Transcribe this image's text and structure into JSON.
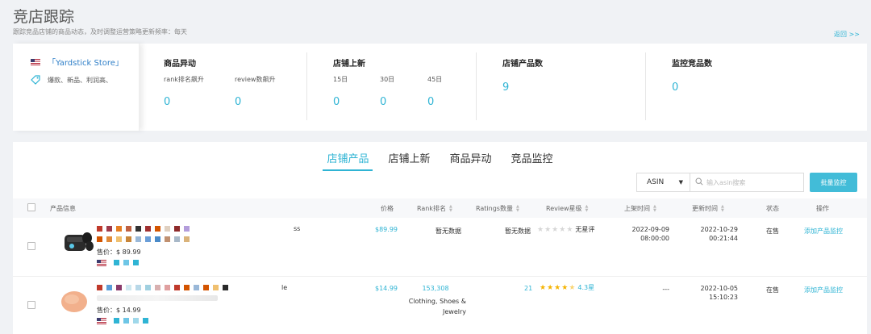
{
  "header": {
    "title": "竞店跟踪",
    "subtitle": "跟踪竞品店铺的商品动态，及时调整运营策略更新频率：每天",
    "back_label": "返回 >>"
  },
  "store": {
    "name": "「Yardstick Store」",
    "tags": "爆款、新品、利润高、"
  },
  "stats": {
    "product_change": {
      "title": "商品异动",
      "rank_label": "rank排名飙升",
      "rank_value": "0",
      "review_label": "review数飙升",
      "review_value": "0"
    },
    "new_listing": {
      "title": "店铺上新",
      "d15_label": "15日",
      "d15_value": "0",
      "d30_label": "30日",
      "d30_value": "0",
      "d45_label": "45日",
      "d45_value": "0"
    },
    "product_count": {
      "title": "店铺产品数",
      "value": "9"
    },
    "monitor_count": {
      "title": "监控竞品数",
      "value": "0"
    }
  },
  "tabs": [
    "店铺产品",
    "店铺上新",
    "商品异动",
    "竞品监控"
  ],
  "active_tab": 0,
  "search": {
    "select_value": "ASIN",
    "placeholder": "输入asin搜索"
  },
  "bulk_button": "批量监控",
  "table": {
    "headers": {
      "product": "产品信息",
      "price": "价格",
      "rank": "Rank排名",
      "ratings": "Ratings数量",
      "review": "Review星级",
      "listed": "上架时间",
      "updated": "更新时间",
      "status": "状态",
      "action": "操作"
    },
    "rows": [
      {
        "title_tail": "ss",
        "sale_price": "售价：$ 89.99",
        "price": "$89.99",
        "rank": "暂无数据",
        "rank_category": "",
        "ratings": "暂无数据",
        "stars_full": 0,
        "review_text": "无星评",
        "listed_date": "2022-09-09",
        "listed_time": "08:00:00",
        "updated_date": "2022-10-29",
        "updated_time": "00:21:44",
        "status": "在售",
        "action": "添加产品监控"
      },
      {
        "title_tail": "le",
        "sale_price": "售价：$ 14.99",
        "price": "$14.99",
        "rank": "153,308",
        "rank_category": "Clothing, Shoes & Jewelry",
        "ratings": "21",
        "stars_full": 4.3,
        "review_text": "4.3星",
        "listed_date": "---",
        "listed_time": "",
        "updated_date": "2022-10-05",
        "updated_time": "15:10:23",
        "status": "在售",
        "action": "添加产品监控"
      }
    ]
  }
}
